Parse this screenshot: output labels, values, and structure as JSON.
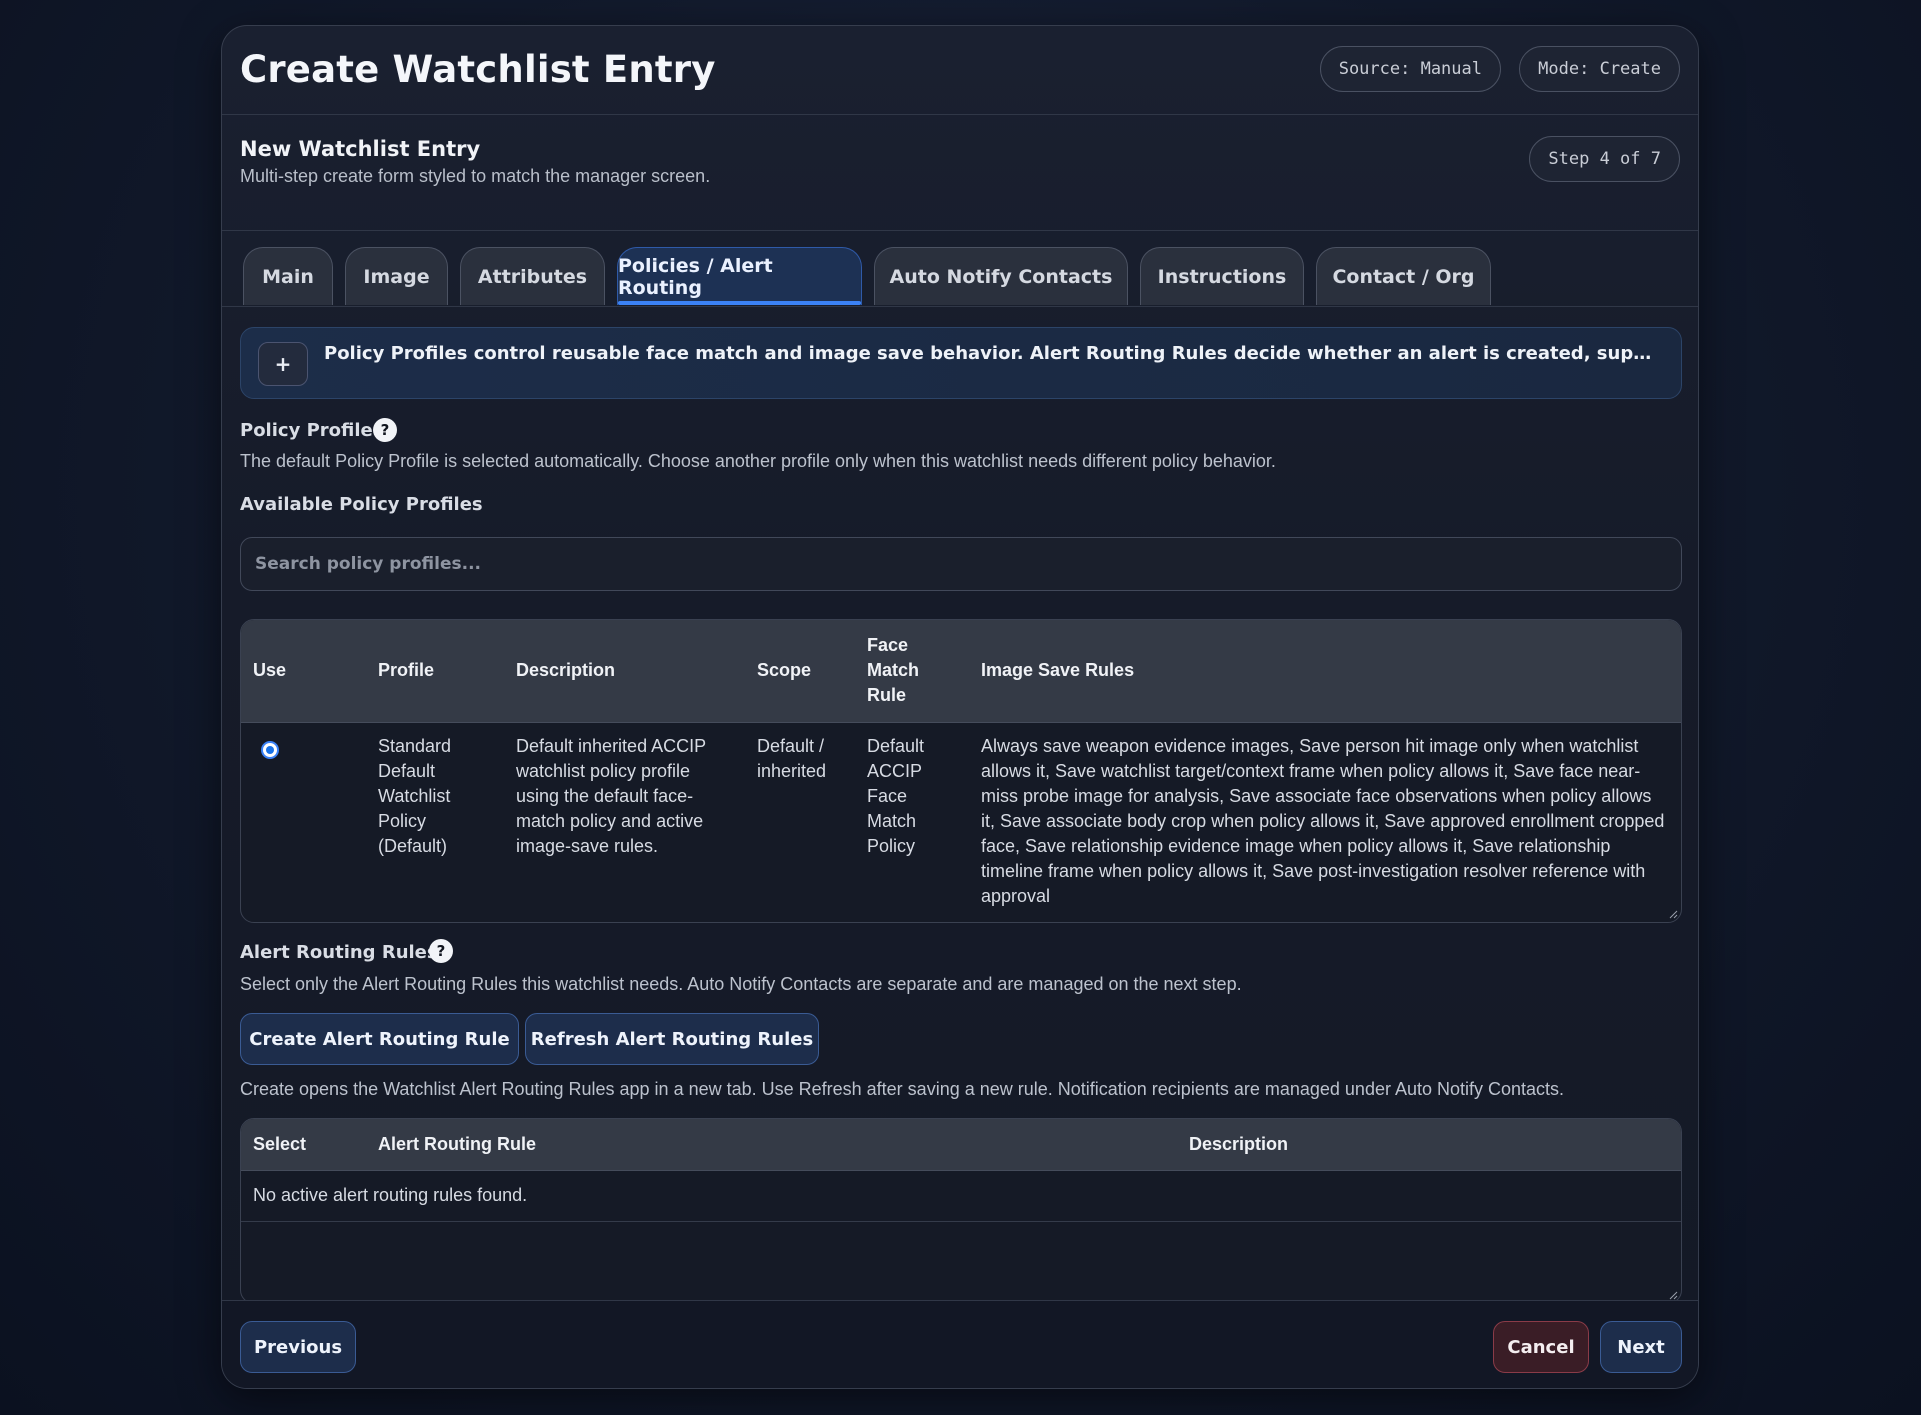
{
  "header": {
    "title": "Create Watchlist Entry",
    "source_pill": "Source: Manual",
    "mode_pill": "Mode: Create"
  },
  "subheader": {
    "title": "New Watchlist Entry",
    "description": "Multi-step create form styled to match the manager screen.",
    "step": "Step 4 of 7"
  },
  "tabs": [
    {
      "label": "Main"
    },
    {
      "label": "Image"
    },
    {
      "label": "Attributes"
    },
    {
      "label": "Policies / Alert Routing",
      "active": true
    },
    {
      "label": "Auto Notify Contacts"
    },
    {
      "label": "Instructions"
    },
    {
      "label": "Contact / Org"
    }
  ],
  "notice": {
    "toggle_label": "+",
    "text": "Policy Profiles control reusable face match and image save behavior. Alert Routing Rules decide whether an alert is created, suppressed, routed, or escalated."
  },
  "policy_profile": {
    "label": "Policy Profile",
    "help_label": "?",
    "description": "The default Policy Profile is selected automatically. Choose another profile only when this watchlist needs different policy behavior.",
    "available_label": "Available Policy Profiles",
    "search_placeholder": "Search policy profiles...",
    "table": {
      "headers": {
        "use": "Use",
        "profile": "Profile",
        "description": "Description",
        "scope": "Scope",
        "face_match_rule": "Face Match Rule",
        "image_save_rules": "Image Save Rules"
      },
      "rows": [
        {
          "selected": true,
          "profile": "Standard Default Watchlist Policy (Default)",
          "description": "Default inherited ACCIP watchlist policy profile using the default face-match policy and active image-save rules.",
          "scope": "Default / inherited",
          "face_match_rule": "Default ACCIP Face Match Policy",
          "image_save_rules": "Always save weapon evidence images, Save person hit image only when watchlist allows it, Save watchlist target/context frame when policy allows it, Save face near-miss probe image for analysis, Save associate face observations when policy allows it, Save associate body crop when policy allows it, Save approved enrollment cropped face, Save relationship evidence image when policy allows it, Save relationship timeline frame when policy allows it, Save post-investigation resolver reference with approval"
        }
      ]
    }
  },
  "alert_routing": {
    "label": "Alert Routing Rules",
    "help_label": "?",
    "description": "Select only the Alert Routing Rules this watchlist needs. Auto Notify Contacts are separate and are managed on the next step.",
    "create_button": "Create Alert Routing Rule",
    "refresh_button": "Refresh Alert Routing Rules",
    "hint": "Create opens the Watchlist Alert Routing Rules app in a new tab. Use Refresh after saving a new rule. Notification recipients are managed under Auto Notify Contacts.",
    "table": {
      "headers": {
        "select": "Select",
        "rule": "Alert Routing Rule",
        "description": "Description"
      },
      "empty_message": "No active alert routing rules found."
    }
  },
  "footer": {
    "previous": "Previous",
    "cancel": "Cancel",
    "next": "Next"
  },
  "colors": {
    "accent": "#3b82f6",
    "active_tab_bg": "#1d3154",
    "cancel_border": "#8a3b48"
  }
}
